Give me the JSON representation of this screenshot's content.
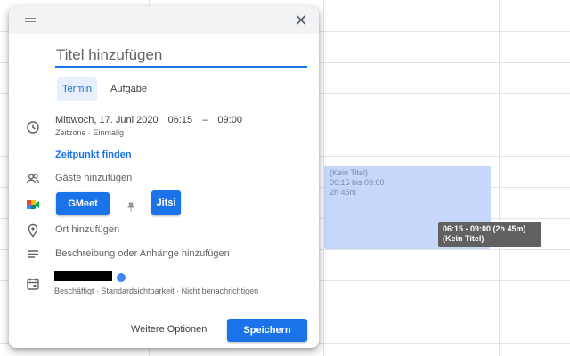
{
  "dialog": {
    "title_placeholder": "Titel hinzufügen",
    "tabs": [
      {
        "label": "Termin",
        "active": true
      },
      {
        "label": "Aufgabe",
        "active": false
      }
    ],
    "date": "Mittwoch, 17. Juni 2020",
    "time_start": "06:15",
    "time_sep": "–",
    "time_end": "09:00",
    "timezone_line": "Zeitzone · Einmalig",
    "find_time": "Zeitpunkt finden",
    "add_guests": "Gäste hinzufügen",
    "conference": {
      "gmeet_label": "GMeet",
      "jitsi_label": "Jitsi"
    },
    "add_location": "Ort hinzufügen",
    "add_description": "Beschreibung oder Anhänge hinzufügen",
    "calendar_meta": "Beschäftigt · Standardsichtbarkeit · Nicht benachrichtigen",
    "more_options": "Weitere Optionen",
    "save": "Speichern",
    "close_icon": "close-icon"
  },
  "event": {
    "title": "(Kein Titel)",
    "time": "06:15 bis 09:00",
    "duration": "2h 45m"
  },
  "tooltip": {
    "line1": "06:15 - 09:00 (2h 45m)",
    "line2": "(Kein Titel)"
  },
  "colors": {
    "accent": "#1a73e8",
    "event_bg": "#c7d7f9",
    "calendar_dot": "#4285f4"
  }
}
